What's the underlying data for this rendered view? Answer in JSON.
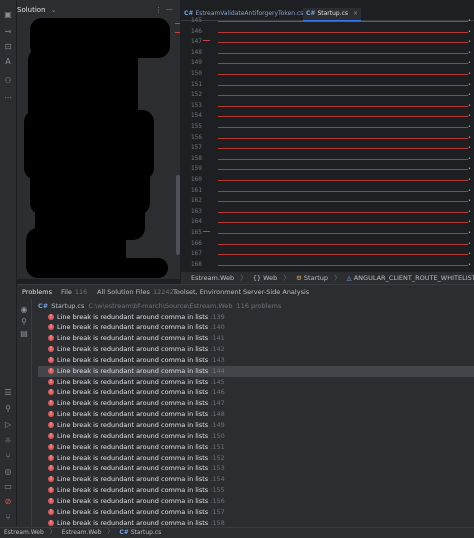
{
  "solution": {
    "title": "Solution"
  },
  "tabs": [
    {
      "icon": "C#",
      "label": "EstreamValidateAntiforgeryToken.cs",
      "active": false
    },
    {
      "icon": "C#",
      "label": "Startup.cs",
      "active": true
    }
  ],
  "editor": {
    "line_numbers": [
      "145",
      "146",
      "147",
      "148",
      "149",
      "150",
      "151",
      "152",
      "153",
      "154",
      "155",
      "156",
      "157",
      "158",
      "159",
      "160",
      "161",
      "162",
      "163",
      "164",
      "165",
      "166",
      "167",
      "168"
    ]
  },
  "breadcrumbs": [
    "Estream.Web",
    "Web",
    "Startup",
    "ANGULAR_CLIENT_ROUTE_WHITELIST"
  ],
  "problems_tabs": [
    {
      "label": "Problems",
      "count": ""
    },
    {
      "label": "File",
      "count": "116"
    },
    {
      "label": "All Solution Files",
      "count": "12242"
    },
    {
      "label": "Toolset, Environment",
      "count": ""
    },
    {
      "label": "Server-Side Analysis",
      "count": ""
    }
  ],
  "problems": {
    "file_icon": "C#",
    "file": "Startup.cs",
    "path": "C:\\w\\estream\\bf-march\\Source\\Estream.Web",
    "summary": "116 problems",
    "message": "Line break is redundant around comma in lists",
    "lines": [
      ":139",
      ":140",
      ":141",
      ":142",
      ":143",
      ":144",
      ":145",
      ":146",
      ":147",
      ":148",
      ":149",
      ":150",
      ":151",
      ":152",
      ":153",
      ":154",
      ":155",
      ":156",
      ":157",
      ":158"
    ],
    "selected_index": 5
  },
  "statusbar": [
    "Estream.Web",
    "Estream.Web",
    "Startup.cs"
  ],
  "colors": {
    "error": "#db5c5c",
    "accent": "#3574f0",
    "highlight_line": "#cf3f3a"
  }
}
